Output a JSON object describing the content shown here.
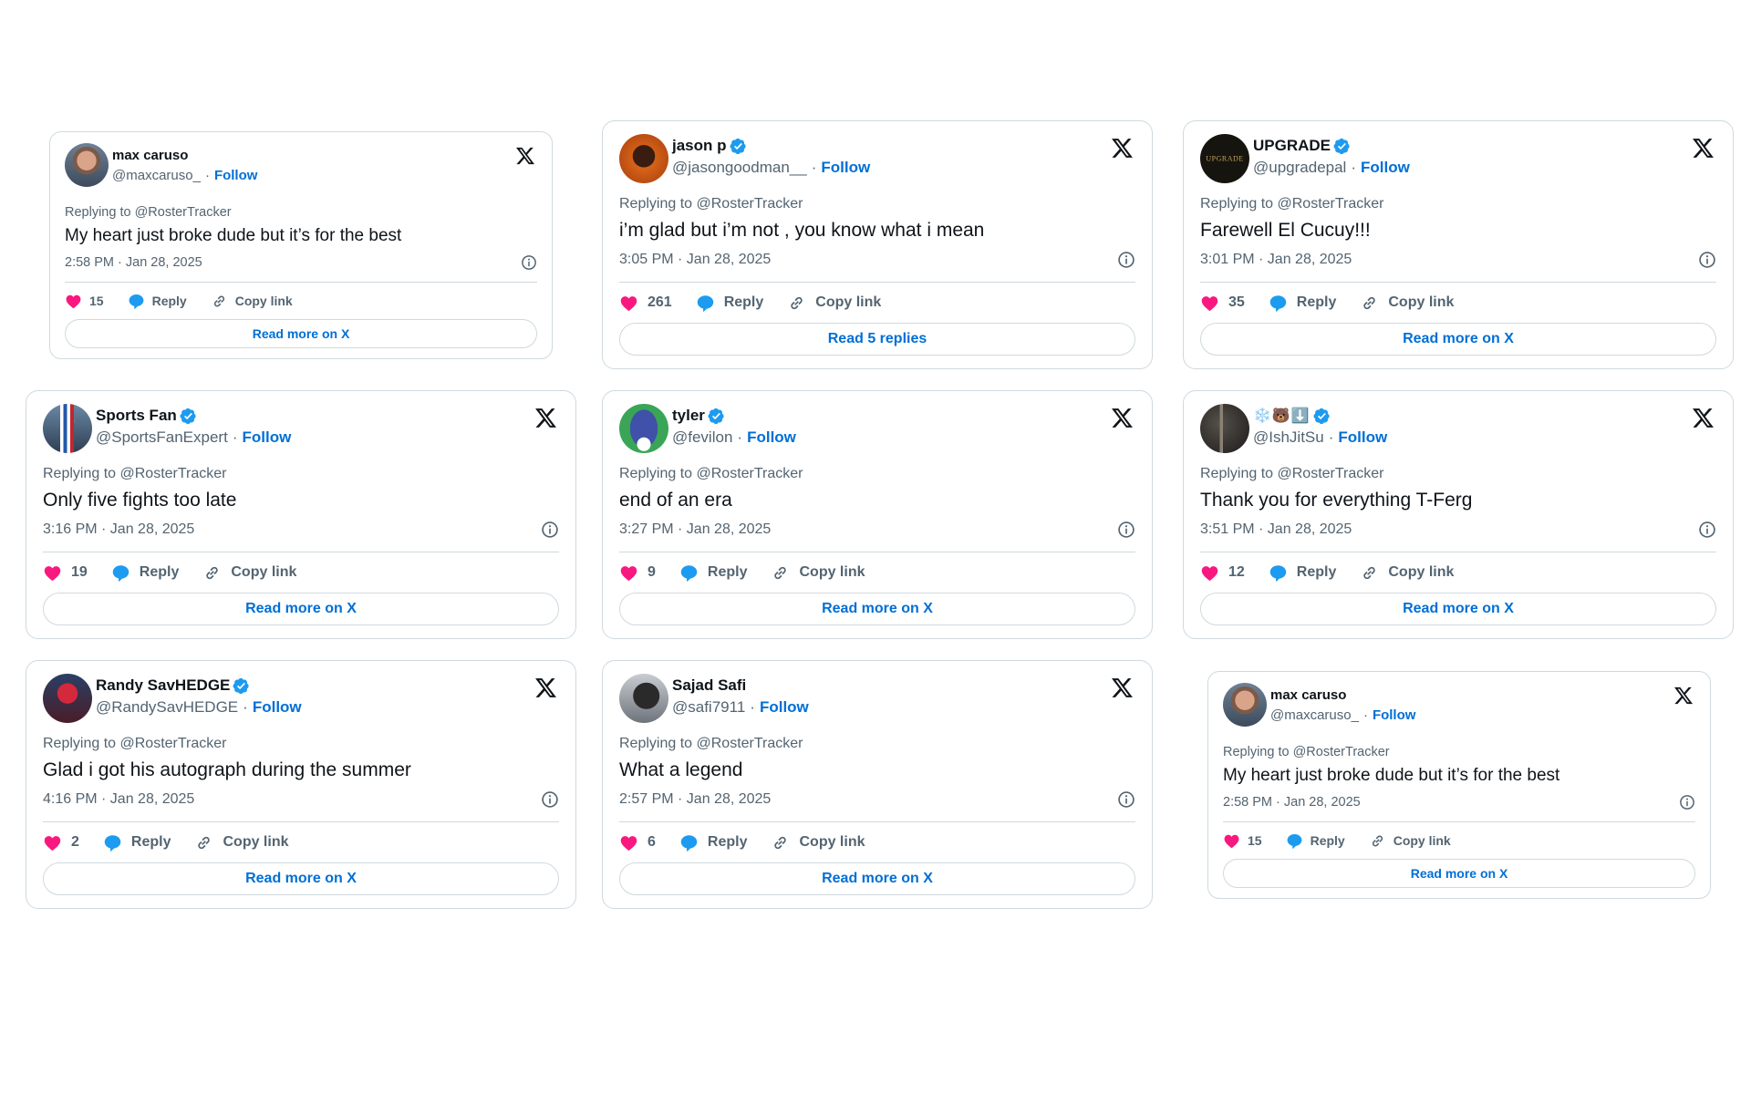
{
  "colors": {
    "accent": "#006fd6",
    "like": "#f91880",
    "reply": "#1d9bf0",
    "verified": "#1d9bf0",
    "muted": "#536471",
    "border": "#cfd9de"
  },
  "common": {
    "follow_label": "Follow",
    "reply_label": "Reply",
    "copy_link_label": "Copy link",
    "dot": "·"
  },
  "tweets": [
    {
      "name": "max caruso",
      "verified": false,
      "handle": "@maxcaruso_",
      "replying_to": "Replying to @RosterTracker",
      "text": "My heart just broke dude but it’s for the best",
      "time": "2:58 PM · Jan 28, 2025",
      "likes": "15",
      "cta": "Read more on X",
      "avatar": "photo-man"
    },
    {
      "name": "jason p",
      "verified": true,
      "handle": "@jasongoodman__",
      "replying_to": "Replying to @RosterTracker",
      "text": "i’m glad but i’m not , you know what i mean",
      "time": "3:05 PM · Jan 28, 2025",
      "likes": "261",
      "cta": "Read 5 replies",
      "avatar": "photo-orange"
    },
    {
      "name": "UPGRADE",
      "verified": true,
      "handle": "@upgradepal",
      "replying_to": "Replying to @RosterTracker",
      "text": "Farewell El Cucuy!!!",
      "time": "3:01 PM · Jan 28, 2025",
      "likes": "35",
      "cta": "Read more on X",
      "avatar": "logo-upgrade",
      "avatar_text": "UPGRADE"
    },
    {
      "name": "Sports Fan",
      "verified": true,
      "handle": "@SportsFanExpert",
      "replying_to": "Replying to @RosterTracker",
      "text": "Only five fights too late",
      "time": "3:16 PM · Jan 28, 2025",
      "likes": "19",
      "cta": "Read more on X",
      "avatar": "photo-athlete"
    },
    {
      "name": "tyler",
      "verified": true,
      "handle": "@fevilon",
      "replying_to": "Replying to @RosterTracker",
      "text": "end of an era",
      "time": "3:27 PM · Jan 28, 2025",
      "likes": "9",
      "cta": "Read more on X",
      "avatar": "cartoon-green"
    },
    {
      "name": "❄️🐻⬇️",
      "verified": true,
      "handle": "@IshJitSu",
      "replying_to": "Replying to @RosterTracker",
      "text": "Thank you for everything T-Ferg",
      "time": "3:51 PM · Jan 28, 2025",
      "likes": "12",
      "cta": "Read more on X",
      "avatar": "photo-dark"
    },
    {
      "name": "Randy SavHEDGE",
      "verified": true,
      "handle": "@RandySavHEDGE",
      "replying_to": "Replying to @RosterTracker",
      "text": "Glad i got his autograph during the summer",
      "time": "4:16 PM · Jan 28, 2025",
      "likes": "2",
      "cta": "Read more on X",
      "avatar": "photo-wrestler"
    },
    {
      "name": "Sajad Safi",
      "verified": false,
      "handle": "@safi7911",
      "replying_to": "Replying to @RosterTracker",
      "text": "What a legend",
      "time": "2:57 PM · Jan 28, 2025",
      "likes": "6",
      "cta": "Read more on X",
      "avatar": "photo-gray"
    },
    {
      "name": "max caruso",
      "verified": false,
      "handle": "@maxcaruso_",
      "replying_to": "Replying to @RosterTracker",
      "text": "My heart just broke dude but it’s for the best",
      "time": "2:58 PM · Jan 28, 2025",
      "likes": "15",
      "cta": "Read more on X",
      "avatar": "photo-man"
    }
  ]
}
